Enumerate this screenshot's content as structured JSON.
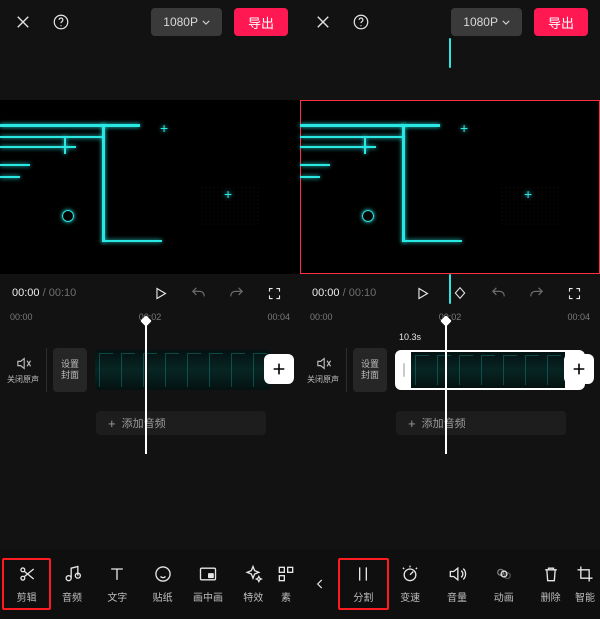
{
  "left": {
    "top": {
      "resolution": "1080P",
      "export": "导出"
    },
    "time": {
      "current": "00:00",
      "sep": " / ",
      "duration": "00:10"
    },
    "ruler": [
      "00:00",
      "00:02",
      "00:04"
    ],
    "audio_off": "关闭原声",
    "cover": "设置\n封面",
    "add_audio": "添加音频",
    "tools": [
      {
        "id": "edit",
        "label": "剪辑"
      },
      {
        "id": "audio",
        "label": "音频"
      },
      {
        "id": "text",
        "label": "文字"
      },
      {
        "id": "sticker",
        "label": "贴纸"
      },
      {
        "id": "pip",
        "label": "画中画"
      },
      {
        "id": "fx",
        "label": "特效"
      },
      {
        "id": "material",
        "label": "素"
      }
    ]
  },
  "right": {
    "top": {
      "resolution": "1080P",
      "export": "导出"
    },
    "time": {
      "current": "00:00",
      "sep": " / ",
      "duration": "00:10"
    },
    "ruler": [
      "00:00",
      "00:02",
      "00:04"
    ],
    "audio_off": "关闭原声",
    "cover": "设置\n封面",
    "clip_badge": "10.3s",
    "add_audio": "添加音频",
    "tools": [
      {
        "id": "split",
        "label": "分割"
      },
      {
        "id": "speed",
        "label": "变速"
      },
      {
        "id": "volume",
        "label": "音量"
      },
      {
        "id": "anim",
        "label": "动画"
      },
      {
        "id": "delete",
        "label": "删除"
      },
      {
        "id": "smart",
        "label": "智能"
      }
    ]
  },
  "icons": {
    "close": "close",
    "help": "help",
    "chevdown": "chevdown",
    "play": "play",
    "undo": "undo",
    "redo": "redo",
    "full": "full",
    "keyframe": "keyframe",
    "mute": "mute",
    "plus": "plus",
    "chev-left": "chev-left"
  }
}
